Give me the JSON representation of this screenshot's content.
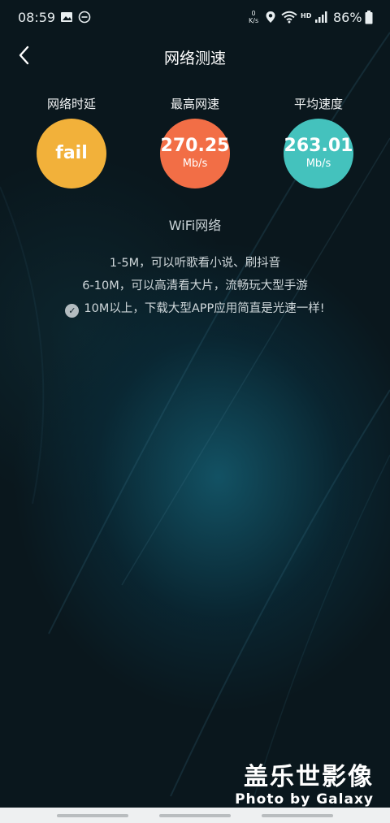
{
  "status_bar": {
    "time": "08:59",
    "net_speed_value": "0",
    "net_speed_unit": "K/s",
    "hd_label": "HD",
    "battery": "86%",
    "icons": [
      "image-icon",
      "do-not-disturb-icon",
      "location-icon",
      "wifi-icon",
      "signal-icon",
      "battery-icon"
    ]
  },
  "header": {
    "title": "网络测速",
    "back_icon": "chevron-left-icon"
  },
  "metrics": [
    {
      "label": "网络时延",
      "value": "fail",
      "unit": "",
      "color": "#f2b13a"
    },
    {
      "label": "最高网速",
      "value": "270.25",
      "unit": "Mb/s",
      "color": "#f26e46"
    },
    {
      "label": "平均速度",
      "value": "263.01",
      "unit": "Mb/s",
      "color": "#44c2bd"
    }
  ],
  "network_type": "WiFi网络",
  "tips": [
    "1-5M，可以听歌看小说、刷抖音",
    "6-10M，可以高清看大片，流畅玩大型手游",
    "10M以上，下载大型APP应用简直是光速一样!"
  ],
  "watermark": {
    "main": "盖乐世影像",
    "sub": "Photo by Galaxy"
  }
}
